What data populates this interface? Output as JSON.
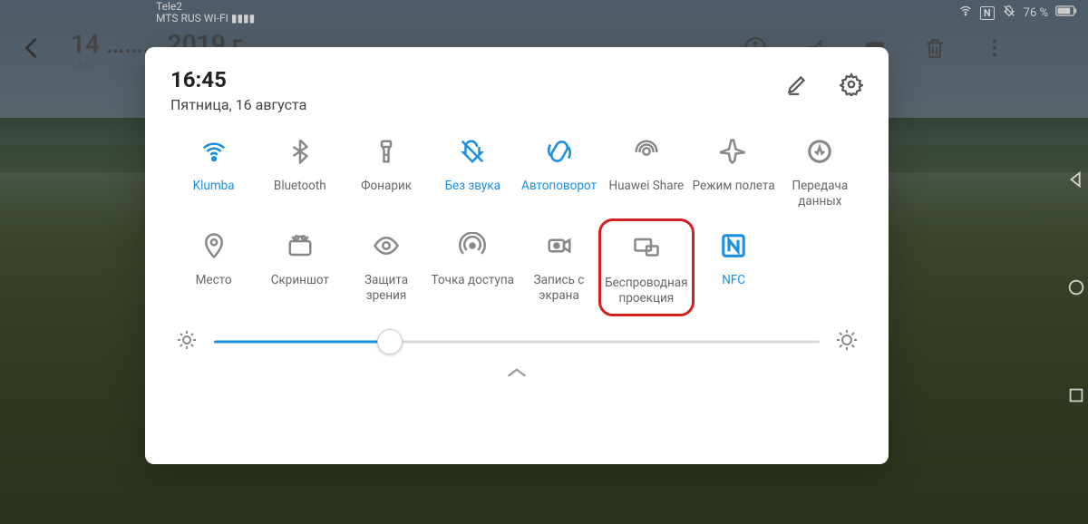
{
  "status": {
    "carrier1": "Tele2",
    "carrier2": "MTS RUS WI-FI ▮▮▮▮",
    "battery": "76 %",
    "nfc": "N"
  },
  "topbar": {
    "date_big": "14 ……… 2019 г.",
    "time_small": "13:0"
  },
  "panel": {
    "time": "16:45",
    "date": "Пятница, 16 августа"
  },
  "tiles": [
    {
      "label": "Klumba",
      "active": true,
      "icon": "wifi"
    },
    {
      "label": "Bluetooth",
      "active": false,
      "icon": "bluetooth"
    },
    {
      "label": "Фонарик",
      "active": false,
      "icon": "flashlight"
    },
    {
      "label": "Без звука",
      "active": true,
      "icon": "mute"
    },
    {
      "label": "Автоповорот",
      "active": true,
      "icon": "rotate"
    },
    {
      "label": "Huawei Share",
      "active": false,
      "icon": "share"
    },
    {
      "label": "Режим полета",
      "active": false,
      "icon": "airplane"
    },
    {
      "label": "Передача данных",
      "active": false,
      "icon": "data"
    },
    {
      "label": "Место",
      "active": false,
      "icon": "location"
    },
    {
      "label": "Скриншот",
      "active": false,
      "icon": "screenshot"
    },
    {
      "label": "Защита зрения",
      "active": false,
      "icon": "eye"
    },
    {
      "label": "Точка доступа",
      "active": false,
      "icon": "hotspot"
    },
    {
      "label": "Запись с экрана",
      "active": false,
      "icon": "record"
    },
    {
      "label": "Беспроводная проекция",
      "active": false,
      "icon": "cast",
      "highlight": true
    },
    {
      "label": "NFC",
      "active": true,
      "icon": "nfc"
    }
  ],
  "brightness": {
    "value": 29
  }
}
